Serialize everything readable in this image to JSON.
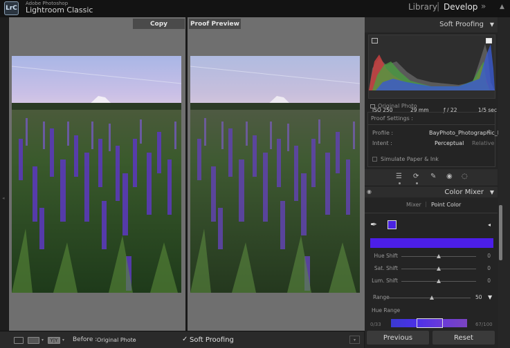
{
  "titlebar": {
    "logo": "LrC",
    "subtitle": "Adobe Photoshop",
    "title": "Lightroom Classic",
    "modules": [
      "Library",
      "Develop"
    ],
    "separator": "|",
    "more_icon": "double-chevron-right-icon"
  },
  "panels": {
    "left_label": "Copy",
    "right_label": "Proof Preview"
  },
  "toolbar": {
    "before_label": "Before :",
    "before_value": "Original Photo",
    "soft_proofing_check": "✓",
    "soft_proofing_label": "Soft Proofing"
  },
  "right_panel": {
    "soft_proofing_title": "Soft Proofing",
    "histogram_meta": {
      "iso": "ISO 250",
      "focal": "29 mm",
      "aperture": "ƒ / 22",
      "shutter": "1/5 sec"
    },
    "original_photo": "Original Photo",
    "proof_settings": "Proof Settings :",
    "profile_label": "Profile :",
    "profile_value": "BayPhoto_Photographic_Lustre",
    "intent_label": "Intent :",
    "intent_perceptual": "Perceptual",
    "intent_relative": "Relative",
    "simulate_paper": "Simulate Paper & Ink",
    "color_mixer_title": "Color Mixer",
    "tab_mixer": "Mixer",
    "tab_separator": "|",
    "tab_point_color": "Point Color",
    "swatch_color": "#4a23e0",
    "sliders": [
      {
        "label": "Hue Shift",
        "value": "0",
        "position": 0.5
      },
      {
        "label": "Sat. Shift",
        "value": "0",
        "position": 0.5
      },
      {
        "label": "Lum. Shift",
        "value": "0",
        "position": 0.5
      }
    ],
    "range_label": "Range",
    "range_value": "50",
    "hue_range_label": "Hue Range",
    "hue_low": "0/33",
    "hue_high": "67/100",
    "btn_previous": "Previous",
    "btn_reset": "Reset"
  }
}
